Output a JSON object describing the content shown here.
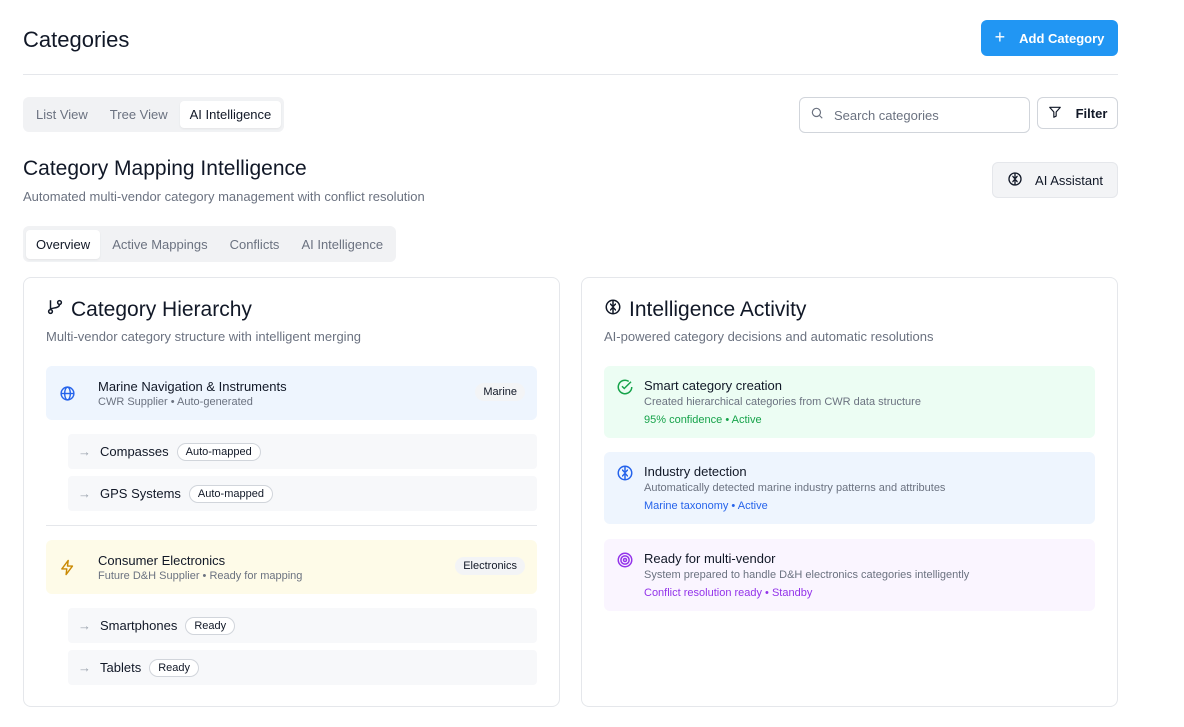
{
  "header": {
    "title": "Categories",
    "add_label": "Add Category"
  },
  "view_tabs": [
    {
      "label": "List View",
      "active": false
    },
    {
      "label": "Tree View",
      "active": false
    },
    {
      "label": "AI Intelligence",
      "active": true
    }
  ],
  "search": {
    "placeholder": "Search categories"
  },
  "filter": {
    "label": "Filter"
  },
  "section": {
    "title": "Category Mapping Intelligence",
    "subtitle": "Automated multi-vendor category management with conflict resolution",
    "ai_button": "AI Assistant"
  },
  "sub_tabs": [
    {
      "label": "Overview",
      "active": true
    },
    {
      "label": "Active Mappings",
      "active": false
    },
    {
      "label": "Conflicts",
      "active": false
    },
    {
      "label": "AI Intelligence",
      "active": false
    }
  ],
  "hierarchy": {
    "title": "Category Hierarchy",
    "subtitle": "Multi-vendor category structure with intelligent merging",
    "groups": [
      {
        "name": "Marine Navigation & Instruments",
        "meta": "CWR Supplier • Auto-generated",
        "tag": "Marine",
        "icon": "globe-icon",
        "children": [
          {
            "name": "Compasses",
            "badge": "Auto-mapped"
          },
          {
            "name": "GPS Systems",
            "badge": "Auto-mapped"
          }
        ]
      },
      {
        "name": "Consumer Electronics",
        "meta": "Future D&H Supplier • Ready for mapping",
        "tag": "Electronics",
        "icon": "lightning-icon",
        "children": [
          {
            "name": "Smartphones",
            "badge": "Ready"
          },
          {
            "name": "Tablets",
            "badge": "Ready"
          }
        ]
      }
    ]
  },
  "activity": {
    "title": "Intelligence Activity",
    "subtitle": "AI-powered category decisions and automatic resolutions",
    "items": [
      {
        "title": "Smart category creation",
        "desc": "Created hierarchical categories from CWR data structure",
        "status": "95% confidence • Active",
        "color": "#16a34a",
        "icon": "check-circle-icon"
      },
      {
        "title": "Industry detection",
        "desc": "Automatically detected marine industry patterns and attributes",
        "status": "Marine taxonomy • Active",
        "color": "#2563eb",
        "icon": "brain-icon"
      },
      {
        "title": "Ready for multi-vendor",
        "desc": "System prepared to handle D&H electronics categories intelligently",
        "status": "Conflict resolution ready • Standby",
        "color": "#9333ea",
        "icon": "target-icon"
      }
    ]
  },
  "colors": {
    "accent": "#2196f3"
  }
}
